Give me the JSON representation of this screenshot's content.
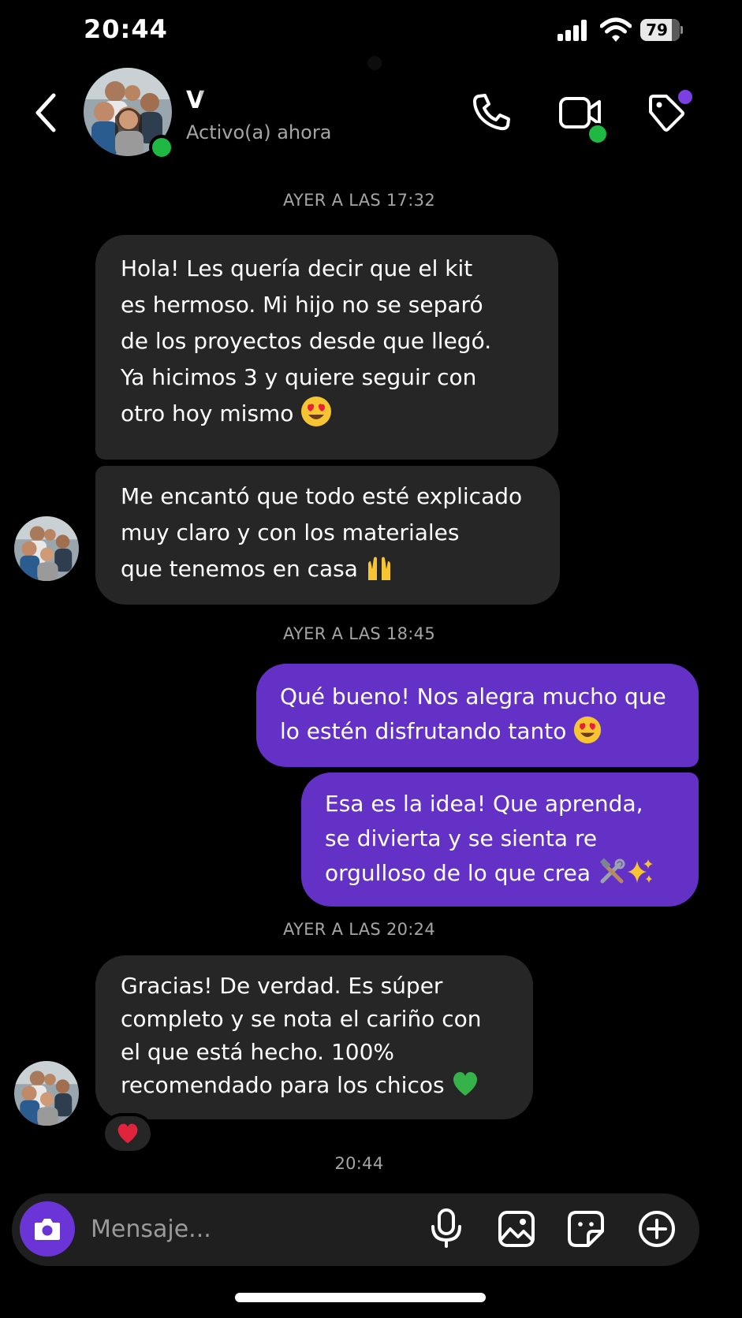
{
  "status_bar": {
    "time": "20:44",
    "battery": "79"
  },
  "header": {
    "contact_name": "V",
    "status": "Activo(a) ahora",
    "icons": [
      "back-chevron-icon",
      "phone-icon",
      "video-camera-icon",
      "tag-icon"
    ]
  },
  "timestamps": {
    "t1": "AYER A LAS 17:32",
    "t2": "AYER A LAS 18:45",
    "t3": "AYER A LAS 20:24",
    "t4": "20:44"
  },
  "messages": [
    {
      "direction": "incoming",
      "lines": [
        "Hola! Les quería decir que el kit",
        "es hermoso. Mi hijo no se separó",
        "de los proyectos desde que llegó.",
        "Ya hicimos 3 y quiere seguir con",
        "otro hoy mismo"
      ],
      "emoji": "smiling-face-with-heart-eyes"
    },
    {
      "direction": "incoming",
      "lines": [
        "Me encantó que todo esté explicado",
        "muy claro y con los materiales",
        "que tenemos en casa"
      ],
      "emoji": "raising-hands"
    },
    {
      "direction": "outgoing",
      "lines": [
        "Qué bueno! Nos alegra mucho que",
        "lo estén disfrutando tanto"
      ],
      "emoji": "smiling-face-with-heart-eyes"
    },
    {
      "direction": "outgoing",
      "lines": [
        "Esa es la idea! Que aprenda,",
        "se divierta y se sienta re",
        "orgulloso de lo que crea"
      ],
      "emoji": "hammer-and-wrench + sparkles"
    },
    {
      "direction": "incoming",
      "lines": [
        "Gracias! De verdad. Es súper",
        "completo y se nota el cariño con",
        "el que está hecho. 100%",
        "recomendado para los chicos"
      ],
      "emoji": "green-heart",
      "reaction": "♥"
    }
  ],
  "composer": {
    "placeholder": "Mensaje..."
  },
  "colors": {
    "background": "#000000",
    "incoming_bubble": "#262626",
    "outgoing_bubble": "#6431c6",
    "accent": "#6a34d6",
    "online": "#1fb842",
    "muted_text": "#a5a5a5"
  }
}
